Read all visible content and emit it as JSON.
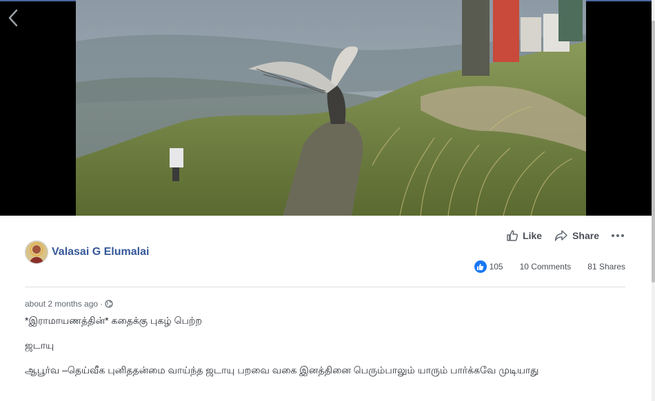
{
  "post": {
    "author": "Valasai G Elumalai",
    "timestamp": "about 2 months ago",
    "separator": "·",
    "privacy_icon": "globe-icon",
    "paragraphs": [
      "*இராமாயணத்தின்* கதைக்கு புகழ் பெற்ற",
      "ஜடாயு",
      "ஆபூர்வ –தெய்வீக புனிததன்மை வாய்ந்த ஜடாயு பறவை வகை இனத்தினை பெரும்பாலும் யாரும் பார்க்கவே முடியாது"
    ]
  },
  "actions": {
    "like_label": "Like",
    "share_label": "Share"
  },
  "stats": {
    "reactions": "105",
    "comments": "10 Comments",
    "shares": "81 Shares"
  },
  "colors": {
    "link": "#365899",
    "like_blue": "#1877f2",
    "video_bg": "#000000"
  }
}
